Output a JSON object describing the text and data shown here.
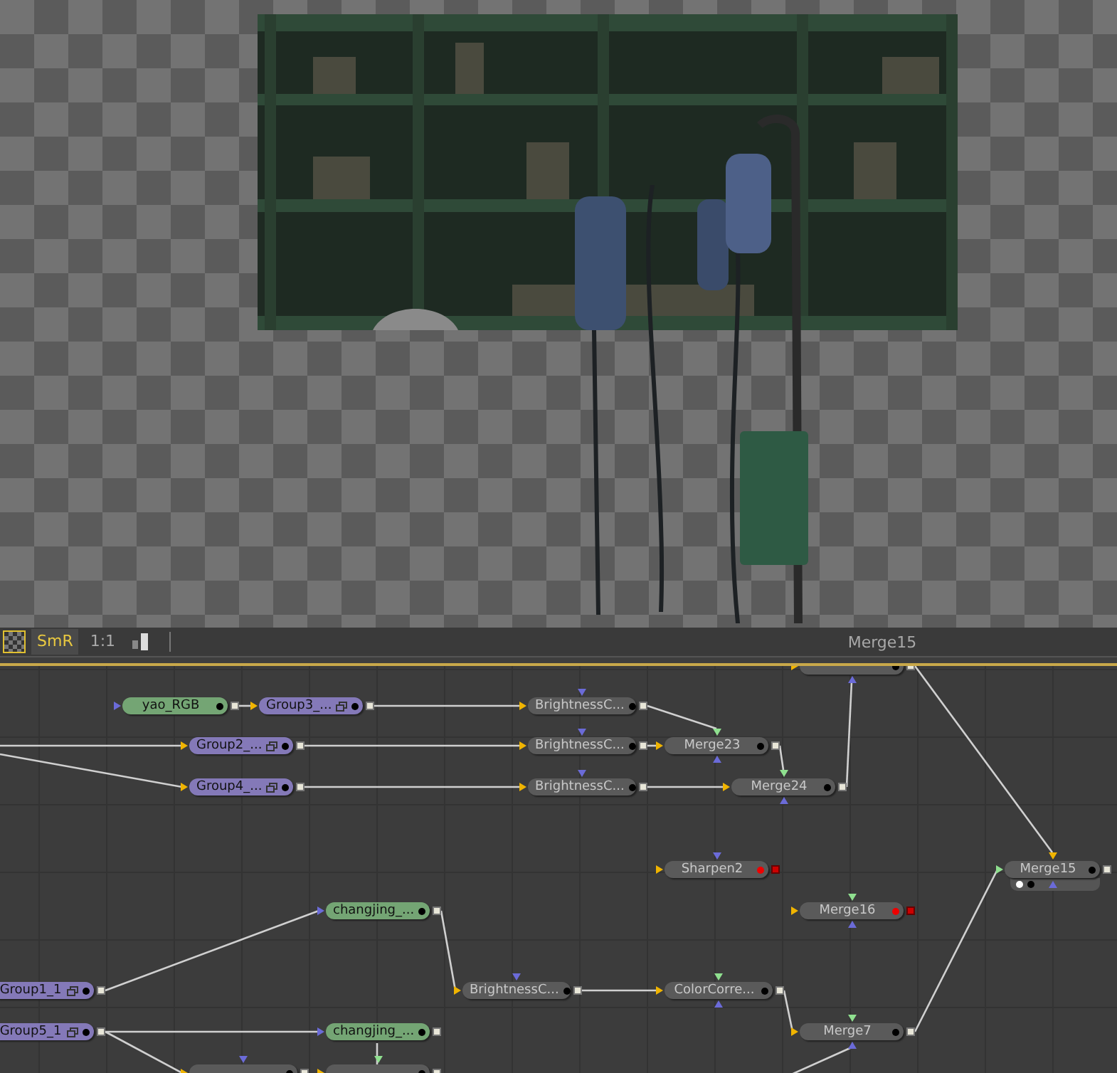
{
  "toolbar": {
    "checker": {
      "selected": true
    },
    "buttons": [
      {
        "label": "SmR",
        "selected": true
      },
      {
        "label": "1:1",
        "selected": false
      }
    ],
    "title": "Merge15"
  },
  "nodes": [
    {
      "kind": "merge",
      "error": false,
      "viewed": false
    },
    {
      "label": "yao_RGB",
      "kind": "loader",
      "error": false,
      "viewed": false
    },
    {
      "label": "Group3_...",
      "kind": "group",
      "error": false,
      "viewed": false
    },
    {
      "label": "BrightnessC...",
      "kind": "tool",
      "error": false,
      "viewed": false
    },
    {
      "label": "Group2_...",
      "kind": "group",
      "error": false,
      "viewed": false
    },
    {
      "label": "BrightnessC...",
      "kind": "tool",
      "error": false,
      "viewed": false
    },
    {
      "label": "Merge23",
      "kind": "merge",
      "error": false,
      "viewed": false
    },
    {
      "label": "Group4_...",
      "kind": "group",
      "error": false,
      "viewed": false
    },
    {
      "label": "BrightnessC...",
      "kind": "tool",
      "error": false,
      "viewed": false
    },
    {
      "label": "Merge24",
      "kind": "merge",
      "error": false,
      "viewed": false
    },
    {
      "label": "Sharpen2",
      "kind": "tool",
      "error": true,
      "viewed": false
    },
    {
      "label": "Merge15",
      "kind": "merge",
      "error": false,
      "viewed": true
    },
    {
      "label": "changjing_...",
      "kind": "loader",
      "error": false,
      "viewed": false
    },
    {
      "label": "Merge16",
      "kind": "merge",
      "error": true,
      "viewed": false
    },
    {
      "label": "Group1_1",
      "kind": "group",
      "error": false,
      "viewed": false
    },
    {
      "label": "BrightnessC...",
      "kind": "tool",
      "error": false,
      "viewed": false
    },
    {
      "label": "ColorCorre...",
      "kind": "merge",
      "error": false,
      "viewed": false
    },
    {
      "label": "Group5_1",
      "kind": "group",
      "error": false,
      "viewed": false
    },
    {
      "label": "changjing_...",
      "kind": "loader",
      "error": false,
      "viewed": false
    },
    {
      "label": "Merge7",
      "kind": "merge",
      "error": false,
      "viewed": false
    },
    {
      "kind": "tool",
      "error": false,
      "viewed": false
    },
    {
      "kind": "merge",
      "error": false,
      "viewed": false
    }
  ]
}
